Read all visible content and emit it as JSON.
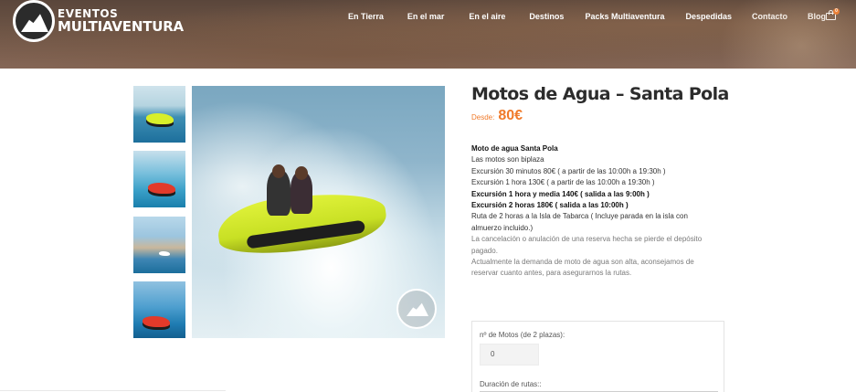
{
  "header": {
    "logo": {
      "line1": "EVENTOS",
      "line2": "MULTIAVENTURA"
    },
    "nav": [
      {
        "label": "En Tierra"
      },
      {
        "label": "En el mar"
      },
      {
        "label": "En el aire"
      },
      {
        "label": "Destinos"
      },
      {
        "label": "Packs Multiaventura"
      },
      {
        "label": "Despedidas"
      },
      {
        "label": "Contacto"
      },
      {
        "label": "Blog"
      }
    ],
    "cart": {
      "icon": "cart-icon",
      "count": "0"
    }
  },
  "gallery": {
    "thumbnails": [
      {
        "icon": "jetski-photo"
      },
      {
        "icon": "jetski-photo"
      },
      {
        "icon": "coast-photo"
      },
      {
        "icon": "jetski-photo"
      }
    ],
    "main_image": "jetski-riders-photo"
  },
  "product": {
    "title": "Motos de Agua – Santa Pola",
    "price_prefix": "Desde:",
    "price": "80€",
    "description": [
      {
        "text": "Moto de agua Santa Pola",
        "style": "b"
      },
      {
        "text": "Las motos son biplaza",
        "style": "n"
      },
      {
        "text": "Excursión 30 minutos 80€    ( a partir de las 10:00h a 19:30h )",
        "style": "n"
      },
      {
        "text": "Excursión 1 hora 130€         ( a partir de las 10:00h a 19:30h )",
        "style": "n"
      },
      {
        "text": "Excursión 1 hora y media 140€ ( salida a las 9:00h )",
        "style": "b"
      },
      {
        "text": "Excursión 2 horas 180€    ( salida a las 10:00h )",
        "style": "b"
      },
      {
        "text": "Ruta de 2 horas a la Isla de Tabarca  ( Incluye parada en la isla con almuerzo incluido.)",
        "style": "wrap"
      },
      {
        "text": "La cancelación o anulación de una reserva hecha se pierde el depósito pagado.",
        "style": "muted"
      },
      {
        "text": "Actualmente la demanda de moto de agua son alta, aconsejamos de reservar cuanto antes, para asegurarnos la rutas.",
        "style": "muted"
      }
    ]
  },
  "form": {
    "quantity_label": "nº de Motos (de 2 plazas):",
    "quantity_value": "0",
    "duration_label": "Duración de rutas::"
  },
  "colors": {
    "accent": "#f07a2a",
    "header_bg": "#6e5546"
  }
}
